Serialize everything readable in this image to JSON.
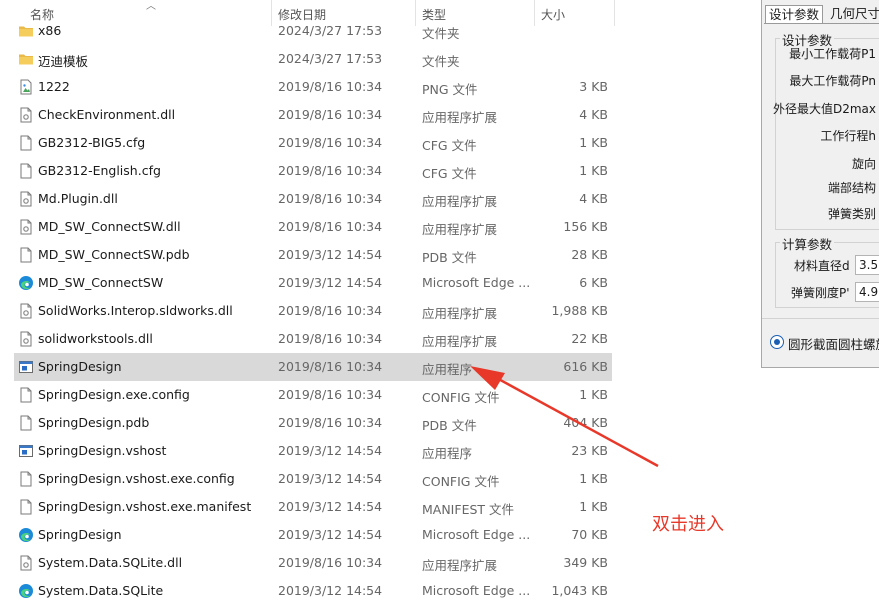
{
  "headers": {
    "name": "名称",
    "date": "修改日期",
    "type": "类型",
    "size": "大小"
  },
  "files": [
    {
      "name": "x86",
      "date": "2024/3/27 17:53",
      "type": "文件夹",
      "size": "",
      "icon": "folder-icon"
    },
    {
      "name": "迈迪模板",
      "date": "2024/3/27 17:53",
      "type": "文件夹",
      "size": "",
      "icon": "folder-icon"
    },
    {
      "name": "1222",
      "date": "2019/8/16 10:34",
      "type": "PNG 文件",
      "size": "3 KB",
      "icon": "image-file-icon"
    },
    {
      "name": "CheckEnvironment.dll",
      "date": "2019/8/16 10:34",
      "type": "应用程序扩展",
      "size": "4 KB",
      "icon": "dll-file-icon"
    },
    {
      "name": "GB2312-BIG5.cfg",
      "date": "2019/8/16 10:34",
      "type": "CFG 文件",
      "size": "1 KB",
      "icon": "file-icon"
    },
    {
      "name": "GB2312-English.cfg",
      "date": "2019/8/16 10:34",
      "type": "CFG 文件",
      "size": "1 KB",
      "icon": "file-icon"
    },
    {
      "name": "Md.Plugin.dll",
      "date": "2019/8/16 10:34",
      "type": "应用程序扩展",
      "size": "4 KB",
      "icon": "dll-file-icon"
    },
    {
      "name": "MD_SW_ConnectSW.dll",
      "date": "2019/8/16 10:34",
      "type": "应用程序扩展",
      "size": "156 KB",
      "icon": "dll-file-icon"
    },
    {
      "name": "MD_SW_ConnectSW.pdb",
      "date": "2019/3/12 14:54",
      "type": "PDB 文件",
      "size": "28 KB",
      "icon": "file-icon"
    },
    {
      "name": "MD_SW_ConnectSW",
      "date": "2019/3/12 14:54",
      "type": "Microsoft Edge ...",
      "size": "6 KB",
      "icon": "edge-icon"
    },
    {
      "name": "SolidWorks.Interop.sldworks.dll",
      "date": "2019/8/16 10:34",
      "type": "应用程序扩展",
      "size": "1,988 KB",
      "icon": "dll-file-icon"
    },
    {
      "name": "solidworkstools.dll",
      "date": "2019/8/16 10:34",
      "type": "应用程序扩展",
      "size": "22 KB",
      "icon": "dll-file-icon"
    },
    {
      "name": "SpringDesign",
      "date": "2019/8/16 10:34",
      "type": "应用程序",
      "size": "616 KB",
      "icon": "app-icon",
      "selected": true
    },
    {
      "name": "SpringDesign.exe.config",
      "date": "2019/8/16 10:34",
      "type": "CONFIG 文件",
      "size": "1 KB",
      "icon": "file-icon"
    },
    {
      "name": "SpringDesign.pdb",
      "date": "2019/8/16 10:34",
      "type": "PDB 文件",
      "size": "404 KB",
      "icon": "file-icon"
    },
    {
      "name": "SpringDesign.vshost",
      "date": "2019/3/12 14:54",
      "type": "应用程序",
      "size": "23 KB",
      "icon": "app-icon"
    },
    {
      "name": "SpringDesign.vshost.exe.config",
      "date": "2019/3/12 14:54",
      "type": "CONFIG 文件",
      "size": "1 KB",
      "icon": "file-icon"
    },
    {
      "name": "SpringDesign.vshost.exe.manifest",
      "date": "2019/3/12 14:54",
      "type": "MANIFEST 文件",
      "size": "1 KB",
      "icon": "file-icon"
    },
    {
      "name": "SpringDesign",
      "date": "2019/3/12 14:54",
      "type": "Microsoft Edge ...",
      "size": "70 KB",
      "icon": "edge-icon"
    },
    {
      "name": "System.Data.SQLite.dll",
      "date": "2019/8/16 10:34",
      "type": "应用程序扩展",
      "size": "349 KB",
      "icon": "dll-file-icon"
    },
    {
      "name": "System.Data.SQLite",
      "date": "2019/3/12 14:54",
      "type": "Microsoft Edge ...",
      "size": "1,043 KB",
      "icon": "edge-icon"
    }
  ],
  "dialog": {
    "tab_design": "设计参数",
    "tab_geometry": "几何尺寸",
    "group_design": "设计参数",
    "min_load": "最小工作载荷P1",
    "max_load": "最大工作载荷Pn",
    "outer_dia_max": "外径最大值D2max",
    "stroke": "工作行程h",
    "rotation": "旋向",
    "end_structure": "端部结构",
    "spring_type": "弹簧类别",
    "group_calc": "计算参数",
    "wire_dia": "材料直径d",
    "wire_dia_value": "3.5",
    "stiffness": "弹簧刚度P'",
    "stiffness_value": "4.9",
    "radio_label": "圆形截面圆柱螺旋"
  },
  "annotation": "双击进入",
  "colors": {
    "selected_row": "#d9d9d9",
    "annotation": "#e8382a",
    "folder": "#e9b949",
    "edge": "#1b8ad8"
  }
}
